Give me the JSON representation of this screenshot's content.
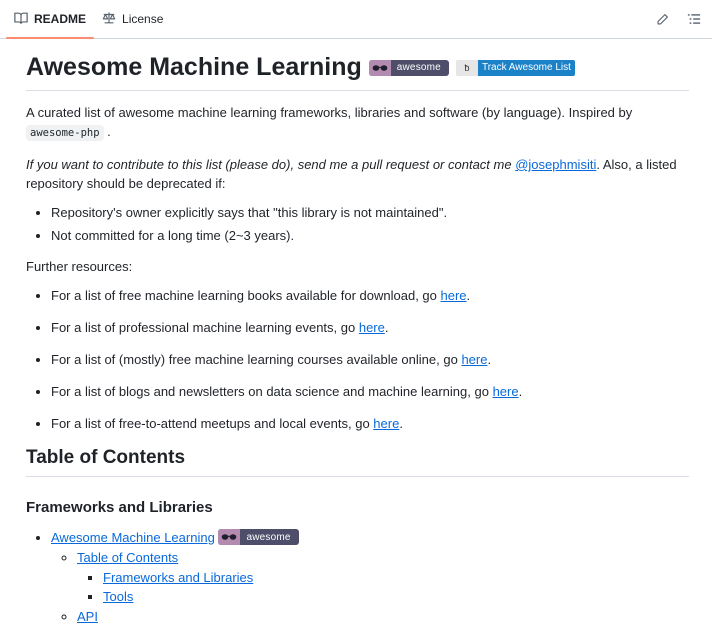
{
  "tabs": {
    "readme": "README",
    "license": "License"
  },
  "title": "Awesome Machine Learning",
  "badges": {
    "awesome": "awesome",
    "track": "Track Awesome List",
    "track_logo": "ƀ"
  },
  "intro": {
    "text": "A curated list of awesome machine learning frameworks, libraries and software (by language). Inspired by",
    "code": "awesome-php",
    "end": "."
  },
  "contribute": {
    "italic": "If you want to contribute to this list (please do), send me a pull request or contact me",
    "link": "@josephmisiti",
    "rest": ". Also, a listed repository should be deprecated if:"
  },
  "deprecated_items": [
    "Repository's owner explicitly says that \"this library is not maintained\".",
    "Not committed for a long time (2~3 years)."
  ],
  "further": "Further resources:",
  "resources": [
    {
      "text": "For a list of free machine learning books available for download, go",
      "link": "here",
      "end": "."
    },
    {
      "text": "For a list of professional machine learning events, go",
      "link": "here",
      "end": "."
    },
    {
      "text": "For a list of (mostly) free machine learning courses available online, go",
      "link": "here",
      "end": "."
    },
    {
      "text": "For a list of blogs and newsletters on data science and machine learning, go",
      "link": "here",
      "end": "."
    },
    {
      "text": "For a list of free-to-attend meetups and local events, go",
      "link": "here",
      "end": "."
    }
  ],
  "toc_heading": "Table of Contents",
  "frameworks_heading": "Frameworks and Libraries",
  "toc": {
    "top": "Awesome Machine Learning",
    "sub": "Table of Contents",
    "subsub": [
      "Frameworks and Libraries",
      "Tools"
    ],
    "next": "API"
  }
}
